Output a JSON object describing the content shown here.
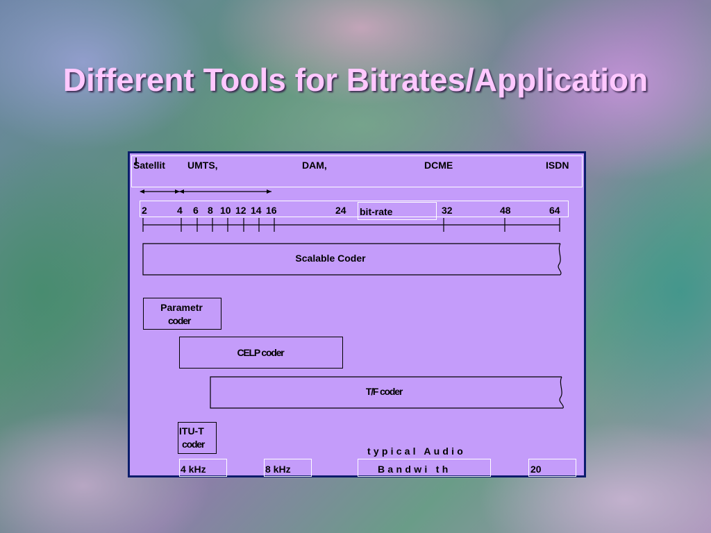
{
  "title": "Different Tools for Bitrates/Application",
  "applications": [
    {
      "label": "Satellit"
    },
    {
      "label": "UMTS,"
    },
    {
      "label": "DAM,"
    },
    {
      "label": "DCME"
    },
    {
      "label": "ISDN"
    }
  ],
  "bitrate_axis": {
    "ticks": [
      "2",
      "4",
      "6",
      "8",
      "10",
      "12",
      "14",
      "16",
      "24",
      "32",
      "48",
      "64"
    ],
    "label": "bit-rate"
  },
  "coders": {
    "scalable": "Scalable Coder",
    "parametric_line1": "Parametr",
    "parametric_line2": "coder",
    "celp": "CELP coder",
    "tf": "T/F coder",
    "itut_line1": "ITU-T",
    "itut_line2": "coder"
  },
  "bandwidth": {
    "caption": "typical Audio",
    "values": [
      "4 kHz",
      "8 kHz",
      "Bandwi th",
      "20"
    ]
  },
  "colors": {
    "panel": "#c49cfa",
    "panel_border": "#0b1c6b",
    "title": "#ffc8ff"
  }
}
